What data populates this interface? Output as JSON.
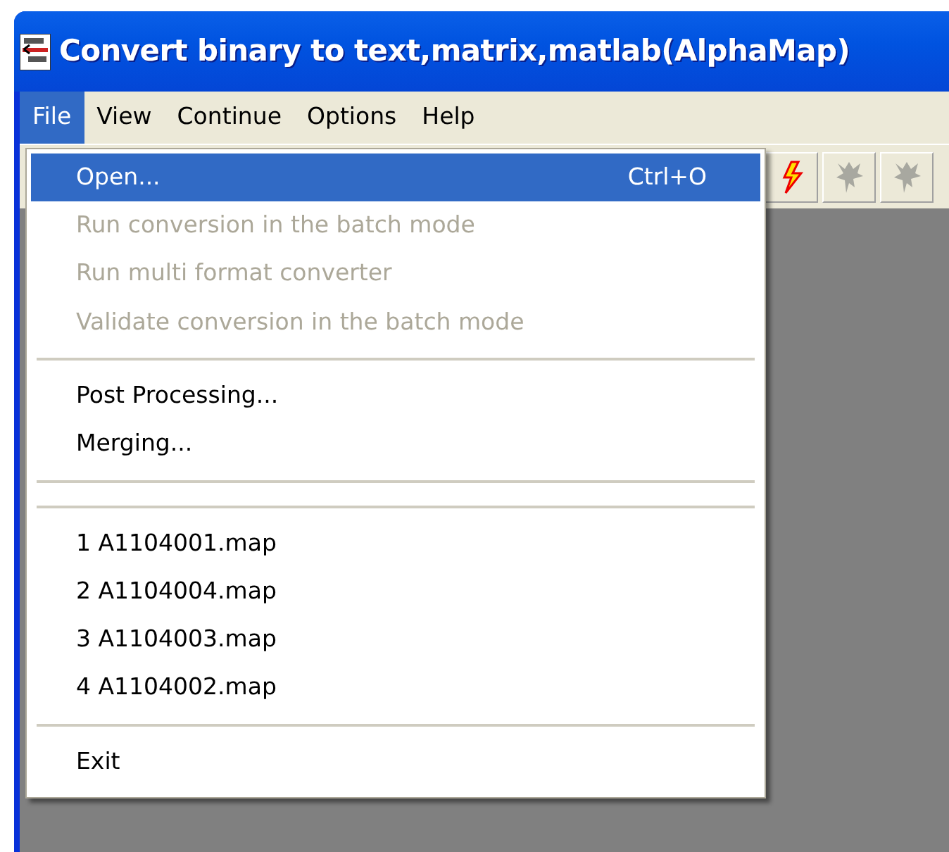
{
  "window": {
    "title": "Convert binary to text,matrix,matlab(AlphaMap)"
  },
  "menu_bar": [
    {
      "label": "File",
      "selected": true
    },
    {
      "label": "View",
      "selected": false
    },
    {
      "label": "Continue",
      "selected": false
    },
    {
      "label": "Options",
      "selected": false
    },
    {
      "label": "Help",
      "selected": false
    }
  ],
  "file_menu": [
    {
      "kind": "item",
      "label": "Open...",
      "shortcut": "Ctrl+O",
      "selected": true,
      "disabled": false
    },
    {
      "kind": "item",
      "label": "Run conversion in the batch mode",
      "selected": false,
      "disabled": true
    },
    {
      "kind": "item",
      "label": "Run multi format converter",
      "selected": false,
      "disabled": true
    },
    {
      "kind": "item",
      "label": "Validate conversion in the batch mode",
      "selected": false,
      "disabled": true
    },
    {
      "kind": "separator"
    },
    {
      "kind": "item",
      "label": "Post Processing...",
      "selected": false,
      "disabled": false
    },
    {
      "kind": "item",
      "label": "Merging...",
      "selected": false,
      "disabled": false
    },
    {
      "kind": "separator"
    },
    {
      "kind": "separator"
    },
    {
      "kind": "item",
      "label": "1 A1104001.map",
      "selected": false,
      "disabled": false
    },
    {
      "kind": "item",
      "label": "2 A1104004.map",
      "selected": false,
      "disabled": false
    },
    {
      "kind": "item",
      "label": "3 A1104003.map",
      "selected": false,
      "disabled": false
    },
    {
      "kind": "item",
      "label": "4 A1104002.map",
      "selected": false,
      "disabled": false
    },
    {
      "kind": "separator"
    },
    {
      "kind": "item",
      "label": "Exit",
      "selected": false,
      "disabled": false
    }
  ],
  "toolbar": [
    {
      "disabled": false
    },
    {
      "disabled": true
    },
    {
      "disabled": true
    }
  ]
}
